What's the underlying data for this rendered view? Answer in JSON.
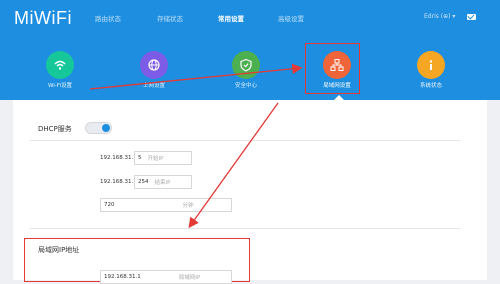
{
  "header": {
    "logo": "MiWiFi",
    "tabs": [
      {
        "label": "路由状态"
      },
      {
        "label": "存储状态"
      },
      {
        "label": "常用设置",
        "active": true
      },
      {
        "label": "高级设置"
      }
    ],
    "user": "Edris (⊕) ▾",
    "mail_icon": "mail-icon"
  },
  "features": [
    {
      "label": "Wi-Fi设置",
      "icon": "wifi-icon",
      "color": "#16c79a"
    },
    {
      "label": "上网设置",
      "icon": "globe-icon",
      "color": "#7c5ce6"
    },
    {
      "label": "安全中心",
      "icon": "shield-icon",
      "color": "#4caf50"
    },
    {
      "label": "局域网设置",
      "icon": "network-icon",
      "color": "#f0643a"
    },
    {
      "label": "系统状态",
      "icon": "info-icon",
      "color": "#f5a623"
    }
  ],
  "dhcp": {
    "title": "DHCP服务",
    "enabled": true,
    "start_prefix": "192.168.31.",
    "start_value": "5",
    "start_hint": "开始IP",
    "end_prefix": "192.168.31.",
    "end_value": "254",
    "end_hint": "结束IP",
    "lease_value": "720",
    "lease_hint": "分钟"
  },
  "lan": {
    "title": "局域网IP地址",
    "ip_value": "192.168.31.1",
    "ip_hint": "局域网IP"
  },
  "colors": {
    "brand": "#1d8ee0",
    "highlight": "#e53935"
  }
}
